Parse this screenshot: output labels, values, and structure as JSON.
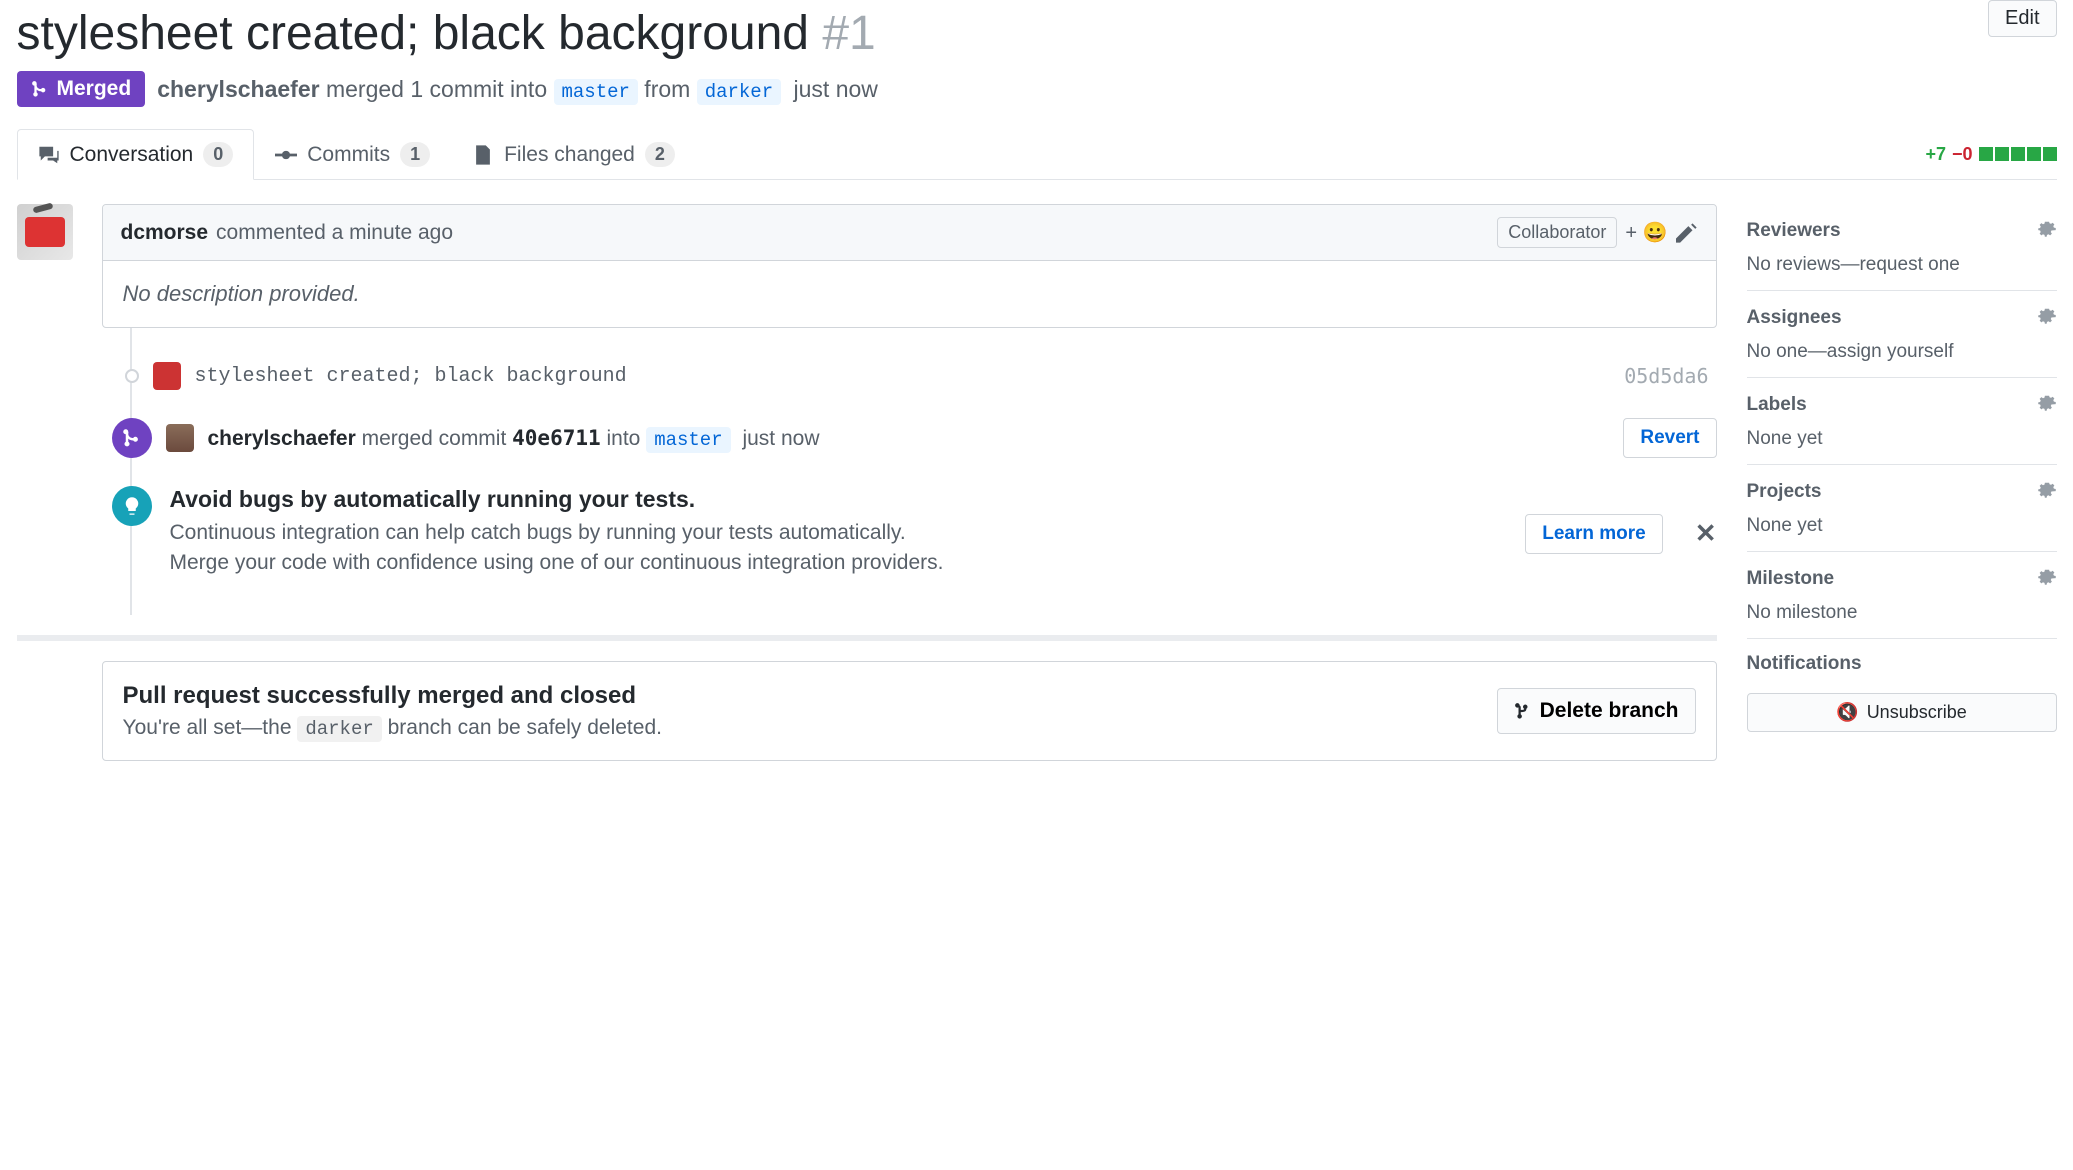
{
  "title": "stylesheet created; black background",
  "issue_number": "#1",
  "edit_button": "Edit",
  "state": {
    "label": "Merged",
    "author": "cherylschaefer",
    "mid_text": " merged 1 commit into ",
    "base_branch": "master",
    "from_text": " from ",
    "head_branch": "darker",
    "time": "just now"
  },
  "tabs": {
    "conversation": {
      "label": "Conversation",
      "count": "0"
    },
    "commits": {
      "label": "Commits",
      "count": "1"
    },
    "files": {
      "label": "Files changed",
      "count": "2"
    }
  },
  "diffstat": {
    "additions": "+7",
    "deletions": "−0"
  },
  "comment": {
    "author": "dcmorse",
    "action": " commented a minute ago",
    "badge": "Collaborator",
    "body": "No description provided."
  },
  "commit_event": {
    "message": "stylesheet created; black background",
    "hash": "05d5da6"
  },
  "merge_event": {
    "author": "cherylschaefer",
    "text1": " merged commit ",
    "commit": "40e6711",
    "text2": " into ",
    "branch": "master",
    "time": "just now",
    "revert": "Revert"
  },
  "ci_hint": {
    "title": "Avoid bugs by automatically running your tests.",
    "line1": "Continuous integration can help catch bugs by running your tests automatically.",
    "line2": "Merge your code with confidence using one of our continuous integration providers.",
    "learn_more": "Learn more"
  },
  "merged_box": {
    "title": "Pull request successfully merged and closed",
    "text1": "You're all set—the ",
    "branch": "darker",
    "text2": " branch can be safely deleted.",
    "delete_button": "Delete branch"
  },
  "sidebar": {
    "reviewers": {
      "title": "Reviewers",
      "text": "No reviews—request one"
    },
    "assignees": {
      "title": "Assignees",
      "text": "No one—assign yourself"
    },
    "labels": {
      "title": "Labels",
      "text": "None yet"
    },
    "projects": {
      "title": "Projects",
      "text": "None yet"
    },
    "milestone": {
      "title": "Milestone",
      "text": "No milestone"
    },
    "notifications": {
      "title": "Notifications",
      "unsubscribe": "Unsubscribe"
    }
  }
}
